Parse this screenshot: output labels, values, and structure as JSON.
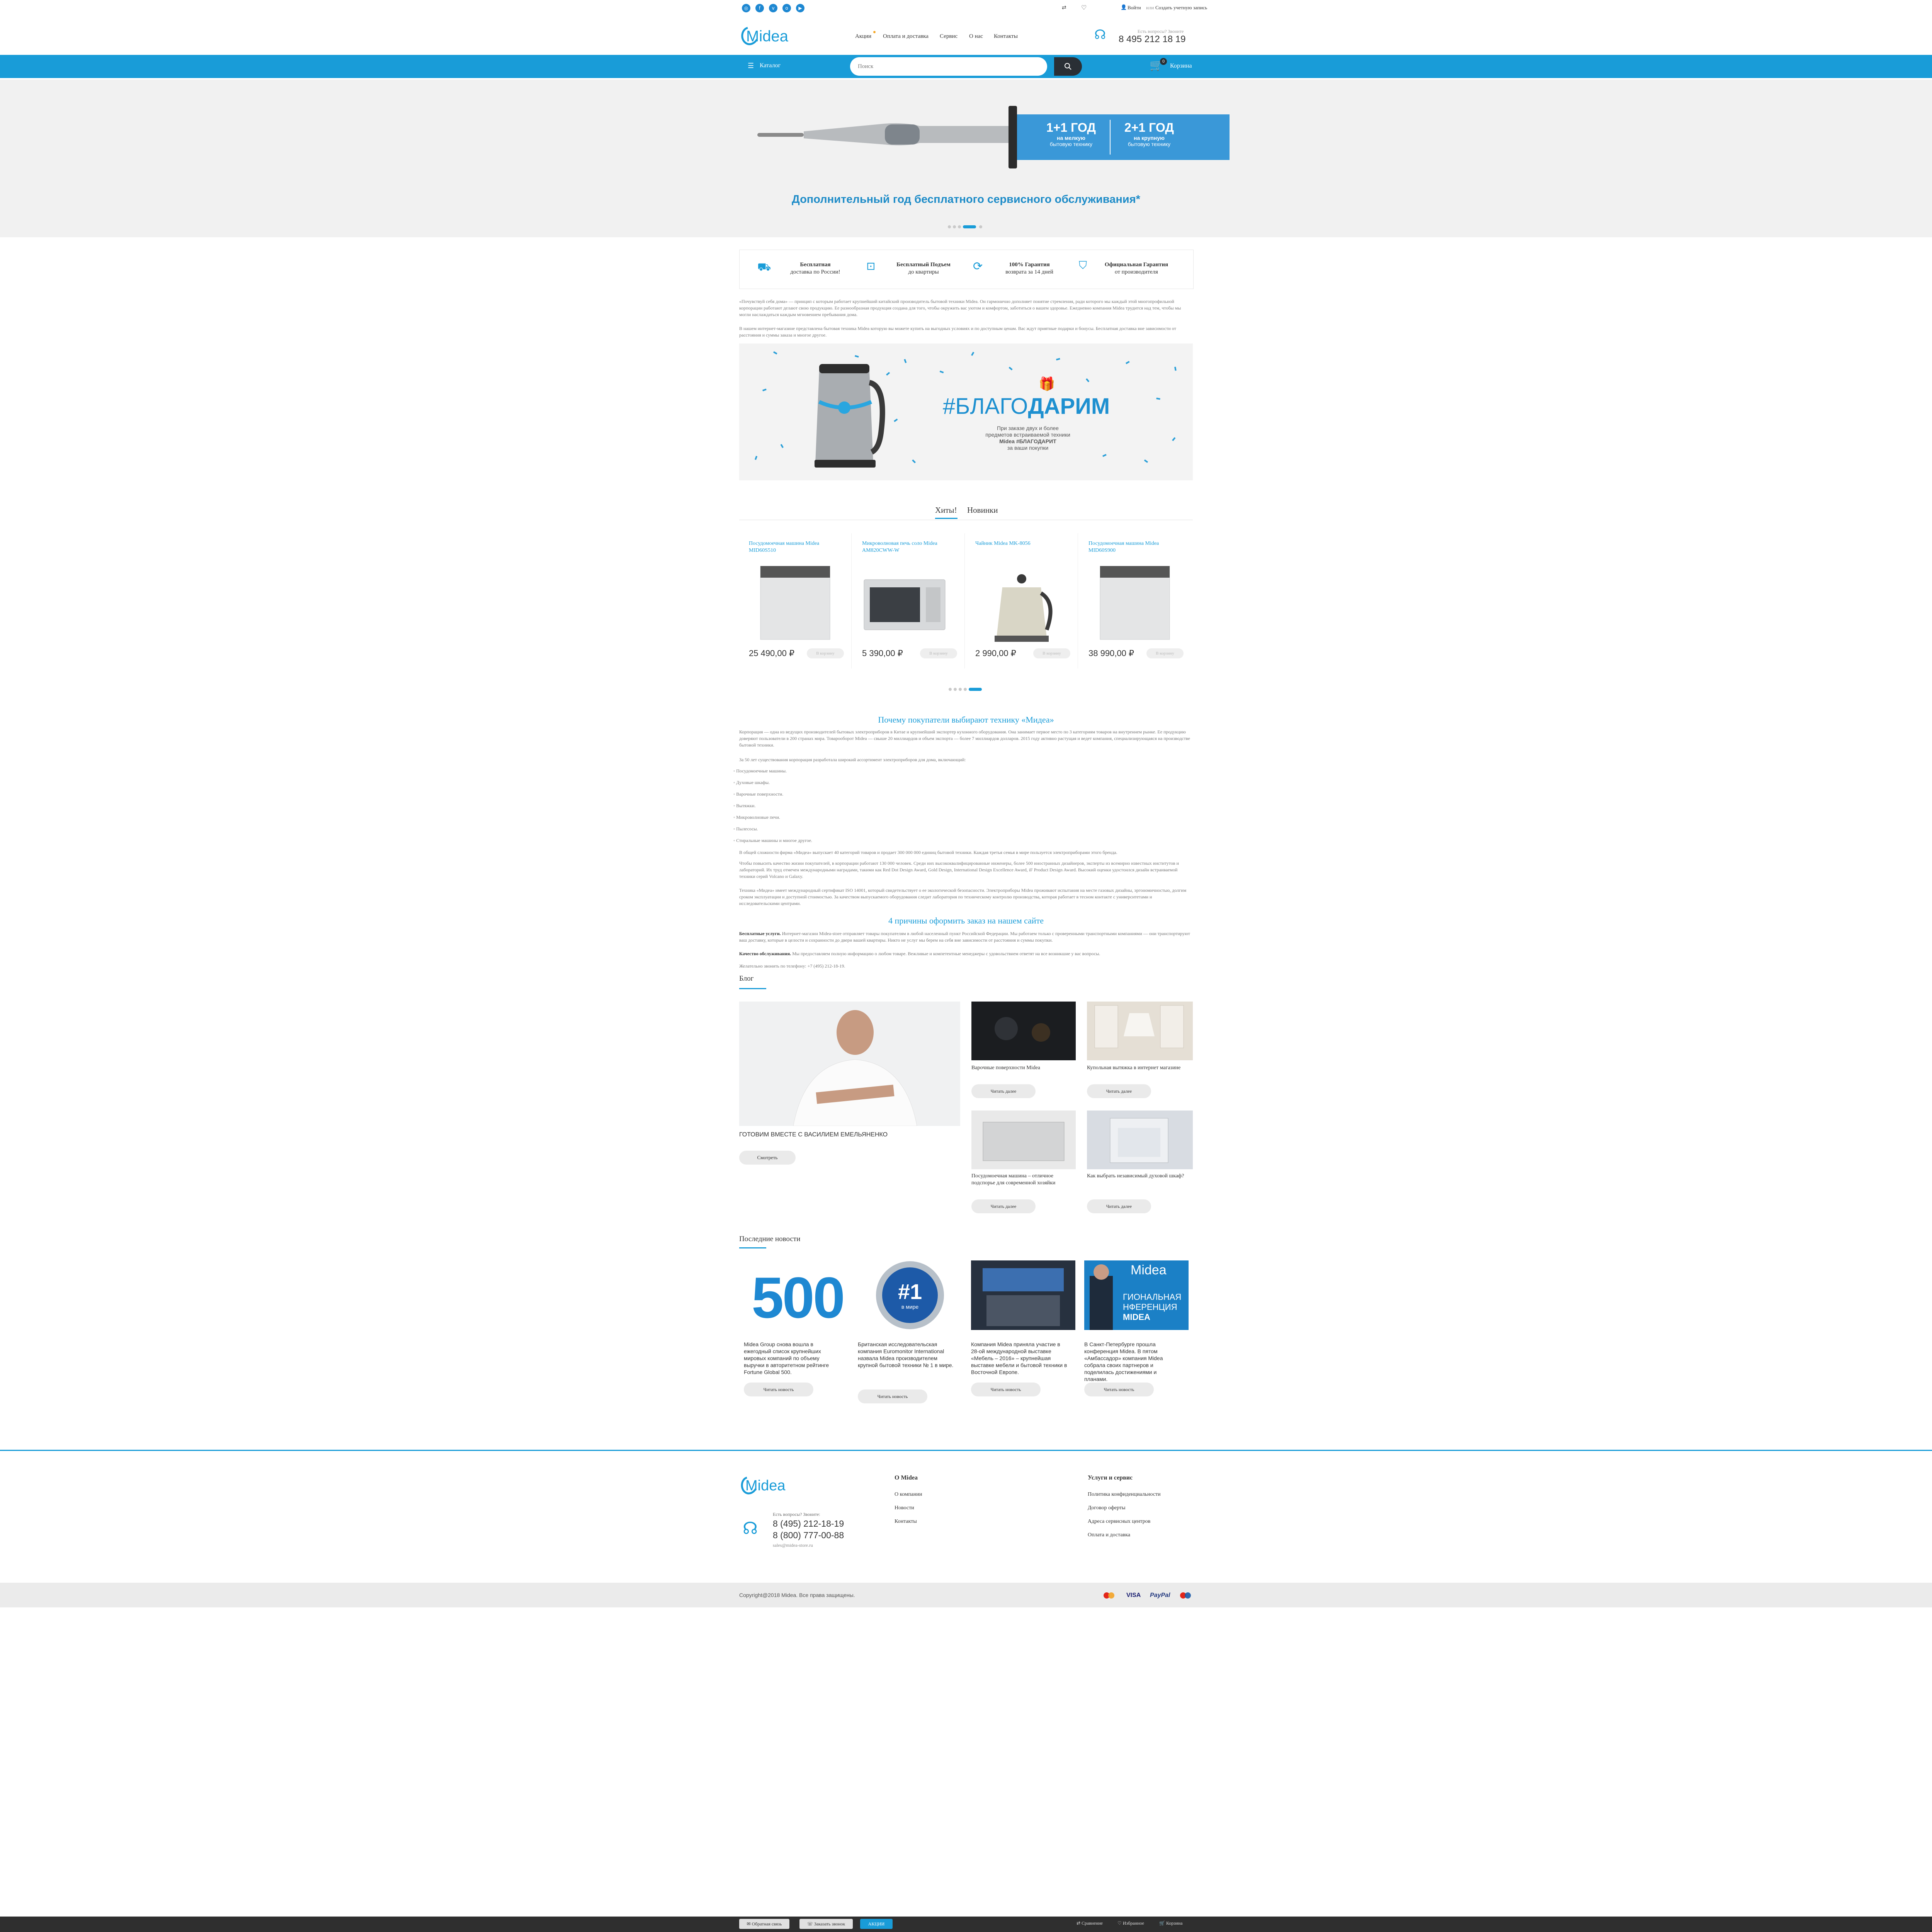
{
  "topbar": {
    "social_icons": [
      "instagram-icon",
      "facebook-icon",
      "vk-icon",
      "odnoklassniki-icon",
      "youtube-icon"
    ],
    "login": "Войти",
    "or": "или",
    "register": "Создать учетную запись"
  },
  "header": {
    "logo": "Midea",
    "nav": [
      "Акции",
      "Оплата и доставка",
      "Сервис",
      "О нас",
      "Контакты"
    ],
    "question": "Есть вопросы? Звоните",
    "phone": "8 495 212 18 19"
  },
  "menubar": {
    "catalog": "Каталог",
    "search_placeholder": "Поиск",
    "cart": "Корзина",
    "cart_count": "0"
  },
  "hero": {
    "badge_left_big": "1+1 ГОД",
    "badge_left_small1": "на мелкую",
    "badge_left_small2": "бытовую технику",
    "badge_right_big": "2+1 ГОД",
    "badge_right_small1": "на крупную",
    "badge_right_small2": "бытовую технику",
    "caption": "Дополнительный год бесплатного сервисного обслуживания*"
  },
  "features": [
    {
      "title": "Бесплатная",
      "sub": "доставка по России!"
    },
    {
      "title": "Бесплатный Подъем",
      "sub": "до квартиры"
    },
    {
      "title": "100% Гарантия",
      "sub": "возврата за 14 дней"
    },
    {
      "title": "Официальная Гарантия",
      "sub": "от производителя"
    }
  ],
  "intro": {
    "p1": "«Почувствуй себя дома» — принцип с которым работает крупнейший китайский производитель бытовой техники Midea. Он гармонично дополняет понятие стремления, ради которого мы каждый этой многопрофильной корпорации работают делают свою продукцию. Ее разнообразная продукция создана для того, чтобы окружить вас уютом и комфортом, заботиться о вашем здоровье. Ежедневно компания Midea трудится над тем, чтобы мы могли наслаждаться каждым мгновением пребывания дома.",
    "p2": "В нашем интернет-магазине представлена бытовая техника Midea которую вы можете купить на выгодных условиях и по доступным ценам. Вас ждут приятные подарки и бонусы. Бесплатная доставка вне зависимости от расстояния и суммы заказа и многое другое."
  },
  "promo_banner": {
    "hashtag_light": "#БЛАГО",
    "hashtag_bold": "ДАРИМ",
    "line1": "При заказе двух и более",
    "line2": "предметов встраиваемой техники",
    "line3": "Midea #БЛАГОДАРИТ",
    "line4": "за ваши покупки"
  },
  "tabs": [
    "Хиты!",
    "Новинки"
  ],
  "products": [
    {
      "name": "Посудомоечная машина Midea MID60S510",
      "price": "25 490,00 ₽",
      "buy": "В корзину"
    },
    {
      "name": "Микроволновая печь соло Midea AM820CWW-W",
      "price": "5 390,00 ₽",
      "buy": "В корзину"
    },
    {
      "name": "Чайник Midea MK-8056",
      "price": "2 990,00 ₽",
      "buy": "В корзину"
    },
    {
      "name": "Посудомоечная машина Midea MID60S900",
      "price": "38 990,00 ₽",
      "buy": "В корзину"
    }
  ],
  "why": {
    "title": "Почему покупатели выбирают технику «Мидеа»",
    "p1": "Корпорация — одна из ведущих производителей бытовых электроприборов в Китае и крупнейший экспортер кухонного оборудования. Она занимает первое место по 3 категориям товаров на внутреннем рынке. Ее продукцию доверяют пользователи в 200 странах мира. Товарооборот Midea — свыше 20 миллиардов и объем экспорта — более 7 миллиардов долларов. 2015 году активно растущая и ведет компания, специализирующаяся на производстве бытовой техники.",
    "p2": "За 50 лет существования корпорация разработала широкий ассортимент электроприборов для дома, включающий:",
    "list": [
      "Посудомоечные машины.",
      "Духовые шкафы.",
      "Варочные поверхности.",
      "Вытяжки.",
      "Микроволновые печи.",
      "Пылесосы.",
      "Стиральные машины и многое другое."
    ],
    "p3": "В общей сложности фирма «Мидеа» выпускает 40 категорий товаров и продает 300 000 000 единиц бытовой техники. Каждая третья семья в мире пользуется электроприборами этого бренда.",
    "p4": "Чтобы повысить качество жизни покупателей, в корпорации работают 130 000 человек. Среди них высококвалифицированные инженеры, более 500 иностранных дизайнеров, эксперты из всемирно известных институтов и лабораторий. Их труд отмечен международными наградами, такими как Red Dot Design Award, Gold Design, International Design Excellence Award, iF Product Design Award. Высокий оценки удостоился дизайн встраиваемой техники серий Volcano и Galaxy.",
    "p5": "Техника «Мидеа» имеет международный сертификат ISO 14001, который свидетельствует о ее экологической безопасности. Электроприборы Midea проживают испытания на месте газовых дизайны, эргономичностью, долгим сроком эксплуатации и доступной стоимостью. За качеством выпускаемого оборудования следит лаборатория по техническому контролю производства, которая работает в тесном контакте с университетами и исследовательскими центрами.",
    "title2": "4 причины оформить заказ на нашем сайте",
    "r1_bold": "Бесплатные услуги.",
    "r1": "Интернет-магазин Midea-store отправляет товары покупателям в любой населенный пункт Российской Федерации. Мы работаем только с проверенными транспортными компаниями — они транспортируют ваш доставку, которые в целости и сохранности до двери вашей квартиры. Никто не услуг мы берем на себя вне зависимости от расстояния и суммы покупки.",
    "r2_bold": "Качество обслуживания.",
    "r2": "Мы предоставляем полную информацию о любом товаре. Вежливые и компетентные менеджеры с удовольствием ответят на все возникшие у вас вопросы.",
    "r3": "Желательно звонить по телефону: +7 (495) 212-18-19."
  },
  "blog": {
    "title": "Блог",
    "main_caption": "ГОТОВИМ ВМЕСТЕ С ВАСИЛИЕМ ЕМЕЛЬЯНЕНКО",
    "main_button": "Смотреть",
    "items": [
      {
        "caption": "Варочные поверхности Midea",
        "button": "Читать далее"
      },
      {
        "caption": "Купольная вытяжка в интернет магазине",
        "button": "Читать далее"
      },
      {
        "caption": "Посудомоечная машина – отличное подспорье для современной хозяйки",
        "button": "Читать далее"
      },
      {
        "caption": "Как выбрать независимый духовой шкаф?",
        "button": "Читать далее"
      }
    ]
  },
  "news": {
    "title": "Последние новости",
    "badge_500": "500",
    "badge_1": "#1",
    "badge_1_sub": "в мире",
    "conf_logo": "Midea",
    "conf_text1": "ГИОНАЛЬНАЯ",
    "conf_text2": "НФЕРЕНЦИЯ",
    "conf_text3": "MIDEA",
    "items": [
      {
        "caption": "Midea Group снова вошла в ежегодный список крупнейших мировых компаний по объему выручки в авторитетном рейтинге Fortune Global 500.",
        "button": "Читать новость"
      },
      {
        "caption": "Британская исследовательская компания Euromonitor International назвала Midea производителем крупной бытовой техники № 1 в мире.",
        "button": "Читать новость"
      },
      {
        "caption": "Компания Midea приняла участие в 28-ой международной выставке «Мебель – 2016» – крупнейшая выставке мебели и бытовой техники в Восточной Европе.",
        "button": "Читать новость"
      },
      {
        "caption": "В Санкт-Петербурге прошла конференция Midea. В пятом «Амбассадор» компания Midea собрала своих партнеров и поделилась достижениями и планами.",
        "button": "Читать новость"
      }
    ]
  },
  "footer": {
    "logo": "Midea",
    "question": "Есть вопросы? Звоните:",
    "phone1": "8 (495) 212-18-19",
    "phone2": "8 (800) 777-00-88",
    "email": "sales@midea-store.ru",
    "col1_title": "О Midea",
    "col1": [
      "О компании",
      "Новости",
      "Контакты"
    ],
    "col2_title": "Услуги и сервис",
    "col2": [
      "Политика конфиденциальности",
      "Договор оферты",
      "Адреса сервисных центров",
      "Оплата и доставка"
    ],
    "copyright": "Copyright@2018 Midea. Все права защищены.",
    "payments": [
      "Maestro",
      "VISA",
      "PayPal",
      "MasterCard"
    ]
  },
  "bottombar": {
    "callback": "Обратная связь",
    "order_call": "Заказать звонок",
    "sales": "АКЦИИ",
    "compare": "Сравнение",
    "favorites": "Избранное",
    "cart": "Корзина"
  },
  "colors": {
    "accent": "#199cd8",
    "dark": "#2a2f35",
    "bottom": "#2f2f2f"
  }
}
